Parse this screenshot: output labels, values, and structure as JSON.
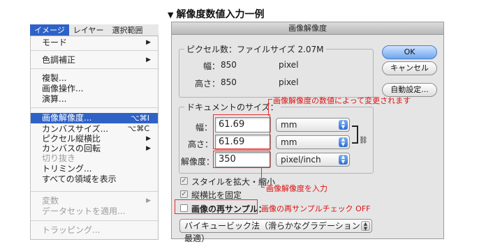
{
  "title": "解像度数値入力一例",
  "menubar": {
    "items": [
      "イメージ",
      "レイヤー",
      "選択範囲"
    ]
  },
  "menu": {
    "items": [
      {
        "label": "モード"
      },
      {
        "label": "色調補正"
      },
      {
        "label": "複製..."
      },
      {
        "label": "画像操作..."
      },
      {
        "label": "演算..."
      },
      {
        "label": "画像解像度...",
        "shortcut": "⌥⌘I"
      },
      {
        "label": "カンバスサイズ...",
        "shortcut": "⌥⌘C"
      },
      {
        "label": "ピクセル縦横比"
      },
      {
        "label": "カンバスの回転"
      },
      {
        "label": "切り抜き"
      },
      {
        "label": "トリミング..."
      },
      {
        "label": "すべての領域を表示"
      },
      {
        "label": "変数"
      },
      {
        "label": "データセットを適用..."
      },
      {
        "label": "トラッピング..."
      }
    ]
  },
  "dialog": {
    "title": "画像解像度",
    "pixel_dims": {
      "legend": "ピクセル数：ファイルサイズ 2.07M",
      "width_label": "幅：",
      "width_value": "850",
      "height_label": "高さ：",
      "height_value": "850",
      "unit": "pixel"
    },
    "doc_size": {
      "legend": "ドキュメントのサイズ：",
      "width_label": "幅：",
      "width_value": "61.69",
      "width_unit": "mm",
      "height_label": "高さ：",
      "height_value": "61.69",
      "height_unit": "mm",
      "res_label": "解像度：",
      "res_value": "350",
      "res_unit": "pixel/inch"
    },
    "buttons": {
      "ok": "OK",
      "cancel": "キャンセル",
      "auto": "自動設定..."
    },
    "checkboxes": {
      "scale_styles": "スタイルを拡大・縮小",
      "constrain": "縦横比を固定",
      "resample": "画像の再サンプル："
    },
    "method": "バイキュービック法（滑らかなグラデーションに最適）"
  },
  "annotations": {
    "doc_note": "画像解像度の数値によって変更されます",
    "res_note": "画像解像度を入力",
    "resample_note": "画像の再サンプルチェック OFF"
  },
  "colors": {
    "accent": "#2e62c7",
    "annotation": "#e03030"
  }
}
